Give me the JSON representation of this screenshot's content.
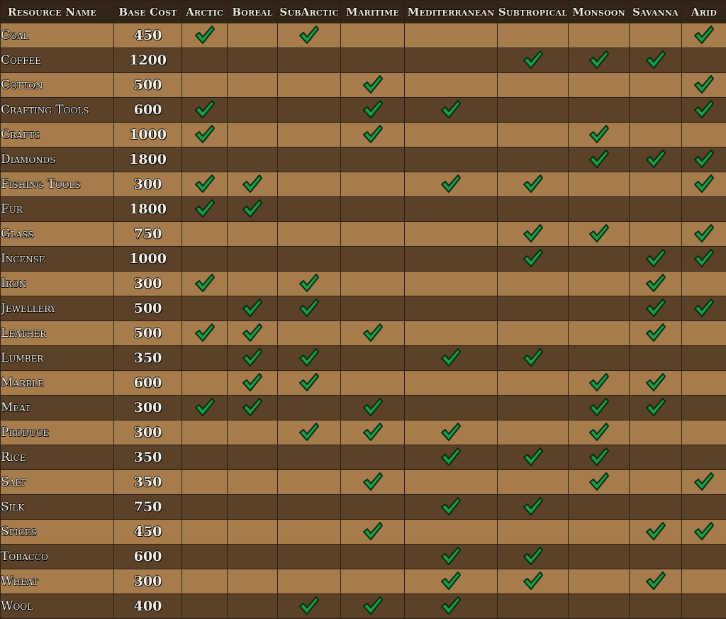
{
  "headers": {
    "name": "Resource Name",
    "cost": "Base Cost",
    "climates": [
      "Arctic",
      "Boreal",
      "SubArctic",
      "Maritime",
      "Mediterranean",
      "Subtropical",
      "Monsoon",
      "Savanna",
      "Arid"
    ]
  },
  "icons": {
    "check": "checkmark-icon"
  },
  "colors": {
    "check_fill": "#1e9b47",
    "row_light": "#a67c4c",
    "row_dark": "#5a4127",
    "header_bg": "#332518"
  },
  "resources": [
    {
      "name": "Coal",
      "cost": "450",
      "climates": [
        "Arctic",
        "SubArctic",
        "Arid"
      ]
    },
    {
      "name": "Coffee",
      "cost": "1200",
      "climates": [
        "Subtropical",
        "Monsoon",
        "Savanna"
      ]
    },
    {
      "name": "Cotton",
      "cost": "500",
      "climates": [
        "Maritime",
        "Arid"
      ]
    },
    {
      "name": "Crafting Tools",
      "cost": "600",
      "climates": [
        "Arctic",
        "Maritime",
        "Mediterranean",
        "Arid"
      ]
    },
    {
      "name": "Crafts",
      "cost": "1000",
      "climates": [
        "Arctic",
        "Maritime",
        "Monsoon"
      ]
    },
    {
      "name": "Diamonds",
      "cost": "1800",
      "climates": [
        "Monsoon",
        "Savanna",
        "Arid"
      ]
    },
    {
      "name": "Fishing Tools",
      "cost": "300",
      "climates": [
        "Arctic",
        "Boreal",
        "Mediterranean",
        "Subtropical",
        "Arid"
      ]
    },
    {
      "name": "Fur",
      "cost": "1800",
      "climates": [
        "Arctic",
        "Boreal"
      ]
    },
    {
      "name": "Glass",
      "cost": "750",
      "climates": [
        "Subtropical",
        "Monsoon",
        "Arid"
      ]
    },
    {
      "name": "Incense",
      "cost": "1000",
      "climates": [
        "Subtropical",
        "Savanna",
        "Arid"
      ]
    },
    {
      "name": "Iron",
      "cost": "300",
      "climates": [
        "Arctic",
        "SubArctic",
        "Savanna"
      ]
    },
    {
      "name": "Jewellery",
      "cost": "500",
      "climates": [
        "Boreal",
        "SubArctic",
        "Savanna",
        "Arid"
      ]
    },
    {
      "name": "Leather",
      "cost": "500",
      "climates": [
        "Arctic",
        "Boreal",
        "Maritime",
        "Savanna"
      ]
    },
    {
      "name": "Lumber",
      "cost": "350",
      "climates": [
        "Boreal",
        "SubArctic",
        "Mediterranean",
        "Subtropical"
      ]
    },
    {
      "name": "Marble",
      "cost": "600",
      "climates": [
        "Boreal",
        "SubArctic",
        "Monsoon",
        "Savanna"
      ]
    },
    {
      "name": "Meat",
      "cost": "300",
      "climates": [
        "Arctic",
        "Boreal",
        "Maritime",
        "Monsoon",
        "Savanna"
      ]
    },
    {
      "name": "Produce",
      "cost": "300",
      "climates": [
        "SubArctic",
        "Maritime",
        "Mediterranean",
        "Monsoon"
      ]
    },
    {
      "name": "Rice",
      "cost": "350",
      "climates": [
        "Mediterranean",
        "Subtropical",
        "Monsoon"
      ]
    },
    {
      "name": "Salt",
      "cost": "350",
      "climates": [
        "Maritime",
        "Monsoon",
        "Arid"
      ]
    },
    {
      "name": "Silk",
      "cost": "750",
      "climates": [
        "Mediterranean",
        "Subtropical"
      ]
    },
    {
      "name": "Spices",
      "cost": "450",
      "climates": [
        "Maritime",
        "Savanna",
        "Arid"
      ]
    },
    {
      "name": "Tobacco",
      "cost": "600",
      "climates": [
        "Mediterranean",
        "Subtropical"
      ]
    },
    {
      "name": "Wheat",
      "cost": "300",
      "climates": [
        "Mediterranean",
        "Subtropical",
        "Savanna"
      ]
    },
    {
      "name": "Wool",
      "cost": "400",
      "climates": [
        "SubArctic",
        "Maritime",
        "Mediterranean"
      ]
    }
  ]
}
